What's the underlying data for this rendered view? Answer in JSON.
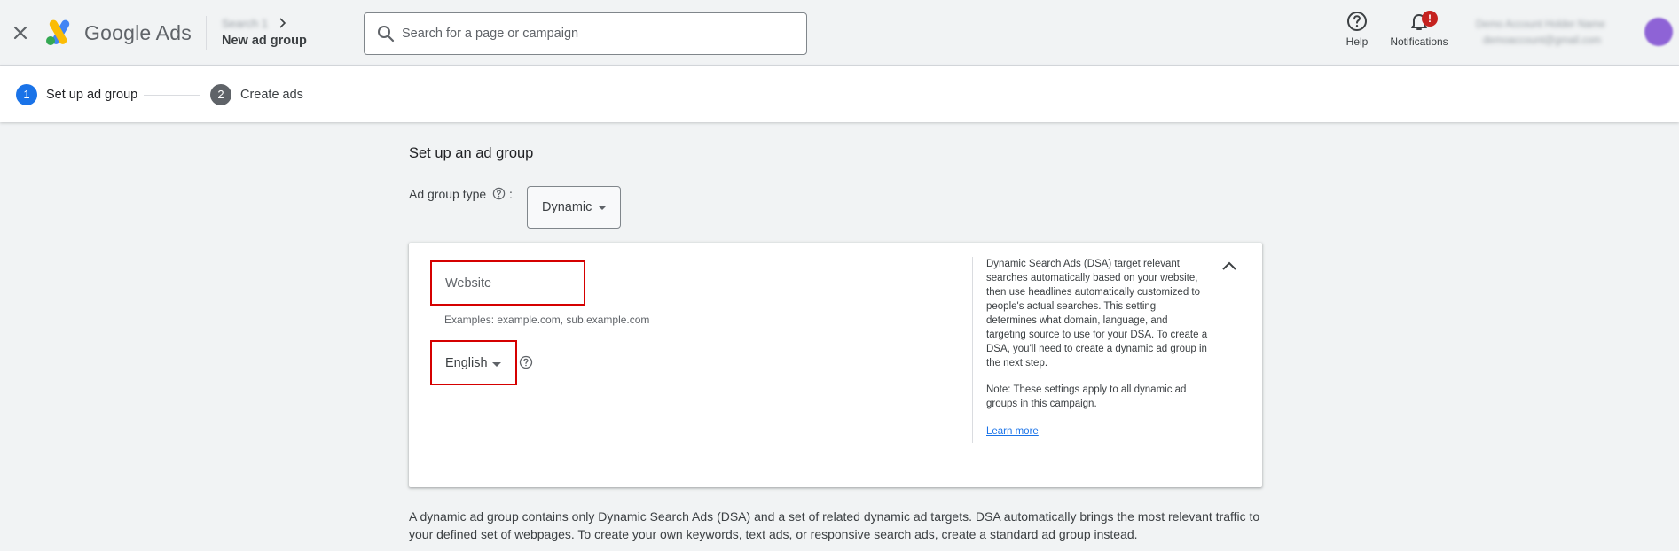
{
  "header": {
    "brand": "Google Ads",
    "breadcrumb_parent": "Search 1",
    "page_title": "New ad group",
    "search": {
      "placeholder": "Search for a page or campaign"
    },
    "help_label": "Help",
    "notifications_label": "Notifications",
    "notifications_badge": "!",
    "account_name": "Demo Account Holder Name",
    "account_email": "demoaccount@gmail.com"
  },
  "stepper": {
    "steps": [
      {
        "number": "1",
        "label": "Set up ad group",
        "active": true
      },
      {
        "number": "2",
        "label": "Create ads",
        "active": false
      }
    ]
  },
  "main": {
    "section_title": "Set up an ad group",
    "ad_group_type_label": "Ad group type",
    "ad_group_type_colon": ":",
    "ad_group_type_value": "Dynamic",
    "card": {
      "website_placeholder": "Website",
      "examples": "Examples: example.com, sub.example.com",
      "language_value": "English",
      "info_text": "Dynamic Search Ads (DSA) target relevant searches automatically based on your website, then use headlines automatically customized to people's actual searches. This setting determines what domain, language, and targeting source to use for your DSA. To create a DSA, you'll need to create a dynamic ad group in the next step.",
      "info_note": "Note: These settings apply to all dynamic ad groups in this campaign.",
      "learn_more": "Learn more"
    },
    "description": "A dynamic ad group contains only Dynamic Search Ads (DSA) and a set of related dynamic ad targets. DSA automatically brings the most relevant traffic to your defined set of webpages. To create your own keywords, text ads, or responsive search ads, create a standard ad group instead."
  },
  "colors": {
    "accent_blue": "#1a73e8",
    "highlight_red": "#d50000",
    "badge_red": "#c5221f"
  }
}
